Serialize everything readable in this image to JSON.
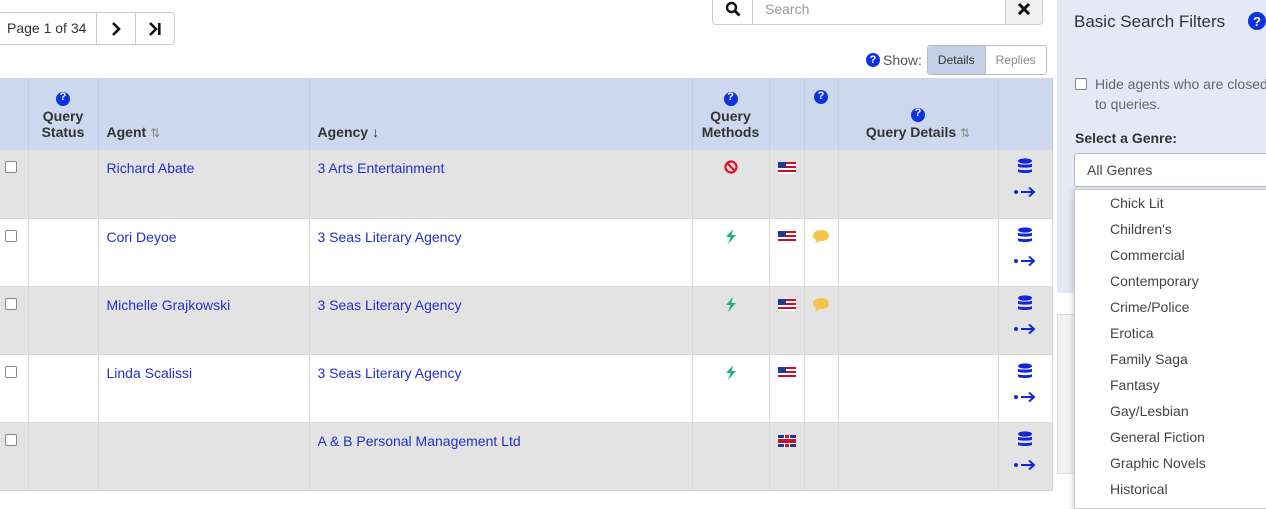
{
  "pager": {
    "label": "Page 1 of 34"
  },
  "search": {
    "placeholder": "Search"
  },
  "show": {
    "label": "Show:",
    "options": [
      "Details",
      "Replies"
    ],
    "active": "Details"
  },
  "columns": {
    "query_status": "Query Status",
    "agent": "Agent",
    "agency": "Agency",
    "query_methods": "Query Methods",
    "query_details": "Query Details"
  },
  "rows": [
    {
      "agent": "Richard Abate",
      "agency": "3 Arts Entertainment",
      "method": "blocked",
      "flag": "us",
      "comment": false
    },
    {
      "agent": "Cori Deyoe",
      "agency": "3 Seas Literary Agency",
      "method": "lightning",
      "flag": "us",
      "comment": true
    },
    {
      "agent": "Michelle Grajkowski",
      "agency": "3 Seas Literary Agency",
      "method": "lightning",
      "flag": "us",
      "comment": true
    },
    {
      "agent": "Linda Scalissi",
      "agency": "3 Seas Literary Agency",
      "method": "lightning",
      "flag": "us",
      "comment": false
    },
    {
      "agent": "",
      "agency": "A & B Personal Management Ltd",
      "method": "",
      "flag": "uk",
      "comment": false
    }
  ],
  "filters": {
    "title": "Basic Search Filters",
    "hide_label": "Hide agents who are closed to queries.",
    "genre_label": "Select a Genre:",
    "genre_selected": "All Genres",
    "genres": [
      "Chick Lit",
      "Children's",
      "Commercial",
      "Contemporary",
      "Crime/Police",
      "Erotica",
      "Family Saga",
      "Fantasy",
      "Gay/Lesbian",
      "General Fiction",
      "Graphic Novels",
      "Historical"
    ]
  },
  "colors": {
    "header_bg": "#cdd8ee",
    "link": "#2230c8",
    "icon_blue": "#0b33e0",
    "lightning": "#22b37a",
    "blocked": "#e0102a",
    "comment": "#f5c24c"
  }
}
